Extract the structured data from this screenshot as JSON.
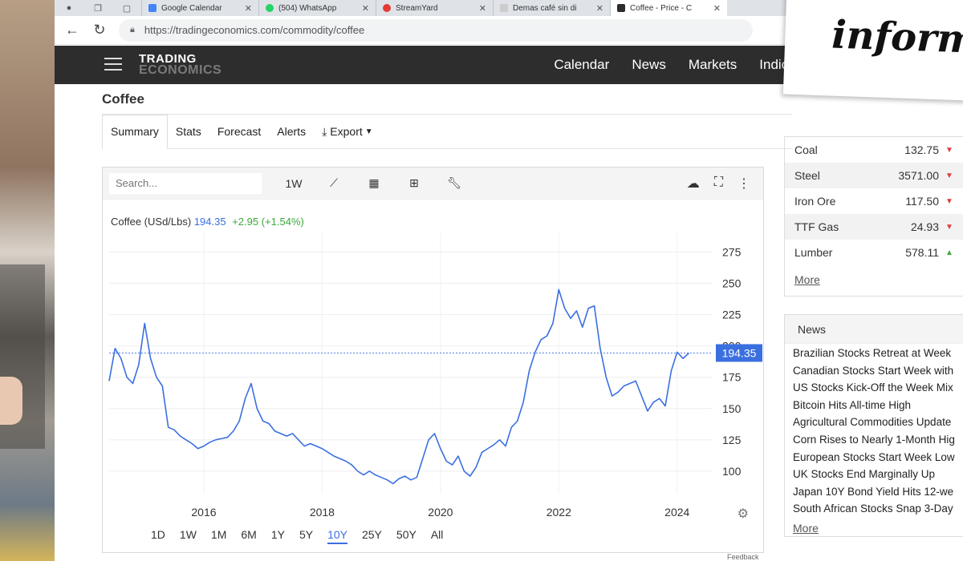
{
  "browser": {
    "tabs": [
      {
        "title": "Google Calendar",
        "color": "#4285f4"
      },
      {
        "title": "(504) WhatsApp",
        "color": "#25d366"
      },
      {
        "title": "StreamYard",
        "color": "#e53935"
      },
      {
        "title": "Demas café sin di",
        "color": "#999999"
      },
      {
        "title": "Coffee - Price - C",
        "color": "#2d2d2d"
      }
    ],
    "url": "https://tradingeconomics.com/commodity/coffee"
  },
  "header": {
    "logo_line1": "TRADING",
    "logo_line2": "ECONOMICS",
    "nav": [
      "Calendar",
      "News",
      "Markets",
      "Indicators"
    ]
  },
  "page": {
    "title": "Coffee",
    "subnav": [
      "Summary",
      "Stats",
      "Forecast",
      "Alerts",
      "Export"
    ]
  },
  "chart": {
    "search_placeholder": "Search...",
    "toolbar_period": "1W",
    "ticker_name": "Coffee (USd/Lbs)",
    "price": "194.35",
    "change": "+2.95 (+1.54%)",
    "current_label": "194.35",
    "ranges": [
      "1D",
      "1W",
      "1M",
      "6M",
      "1Y",
      "5Y",
      "10Y",
      "25Y",
      "50Y",
      "All"
    ],
    "active_range": "10Y",
    "feedback": "Feedback"
  },
  "chart_data": {
    "type": "line",
    "title": "",
    "xlabel": "",
    "ylabel": "",
    "y_ticks": [
      100,
      125,
      150,
      175,
      200,
      225,
      250,
      275
    ],
    "x_ticks": [
      "2016",
      "2018",
      "2020",
      "2022",
      "2024"
    ],
    "ylim": [
      82,
      290
    ],
    "xlim": [
      2014.4,
      2024.6
    ],
    "series": [
      {
        "x": [
          2014.4,
          2014.5,
          2014.6,
          2014.7,
          2014.8,
          2014.9,
          2015.0,
          2015.1,
          2015.2,
          2015.3,
          2015.4,
          2015.5,
          2015.6,
          2015.7,
          2015.8,
          2015.9,
          2016.0,
          2016.1,
          2016.2,
          2016.3,
          2016.4,
          2016.5,
          2016.6,
          2016.7,
          2016.8,
          2016.9,
          2017.0,
          2017.1,
          2017.2,
          2017.3,
          2017.4,
          2017.5,
          2017.6,
          2017.7,
          2017.8,
          2017.9,
          2018.0,
          2018.1,
          2018.2,
          2018.3,
          2018.4,
          2018.5,
          2018.6,
          2018.7,
          2018.8,
          2018.9,
          2019.0,
          2019.1,
          2019.2,
          2019.3,
          2019.4,
          2019.5,
          2019.6,
          2019.7,
          2019.8,
          2019.9,
          2020.0,
          2020.1,
          2020.2,
          2020.3,
          2020.4,
          2020.5,
          2020.6,
          2020.7,
          2020.8,
          2020.9,
          2021.0,
          2021.1,
          2021.2,
          2021.3,
          2021.4,
          2021.5,
          2021.6,
          2021.7,
          2021.8,
          2021.9,
          2022.0,
          2022.1,
          2022.2,
          2022.3,
          2022.4,
          2022.5,
          2022.6,
          2022.7,
          2022.8,
          2022.9,
          2023.0,
          2023.1,
          2023.2,
          2023.3,
          2023.4,
          2023.5,
          2023.6,
          2023.7,
          2023.8,
          2023.9,
          2024.0,
          2024.1,
          2024.2
        ],
        "values": [
          172,
          198,
          190,
          175,
          170,
          185,
          218,
          190,
          175,
          168,
          135,
          133,
          128,
          125,
          122,
          118,
          120,
          123,
          125,
          126,
          127,
          132,
          140,
          158,
          170,
          150,
          140,
          138,
          132,
          130,
          128,
          130,
          125,
          120,
          122,
          120,
          118,
          115,
          112,
          110,
          108,
          105,
          100,
          97,
          100,
          97,
          95,
          93,
          90,
          94,
          96,
          93,
          95,
          110,
          125,
          130,
          118,
          108,
          105,
          112,
          100,
          96,
          103,
          115,
          118,
          121,
          125,
          120,
          135,
          140,
          155,
          180,
          195,
          205,
          208,
          218,
          245,
          230,
          222,
          228,
          215,
          230,
          232,
          198,
          175,
          160,
          163,
          168,
          170,
          172,
          160,
          148,
          155,
          158,
          152,
          180,
          195,
          190,
          194.35
        ]
      }
    ]
  },
  "sidebar": {
    "rows": [
      {
        "name": "Coal",
        "value": "132.75",
        "dir": "down"
      },
      {
        "name": "Steel",
        "value": "3571.00",
        "dir": "down"
      },
      {
        "name": "Iron Ore",
        "value": "117.50",
        "dir": "down"
      },
      {
        "name": "TTF Gas",
        "value": "24.93",
        "dir": "down"
      },
      {
        "name": "Lumber",
        "value": "578.11",
        "dir": "up"
      }
    ],
    "more": "More"
  },
  "news": {
    "heading": "News",
    "items": [
      "Brazilian Stocks Retreat at Week",
      "Canadian Stocks Start Week with",
      "US Stocks Kick-Off the Week Mix",
      "Bitcoin Hits All-time High",
      "Agricultural Commodities Update",
      "Corn Rises to Nearly 1-Month Hig",
      "European Stocks Start Week Low",
      "UK Stocks End Marginally Up",
      "Japan 10Y Bond Yield Hits 12-we",
      "South African Stocks Snap 3-Day"
    ],
    "more": "More"
  },
  "overlay": {
    "text": "inform"
  }
}
